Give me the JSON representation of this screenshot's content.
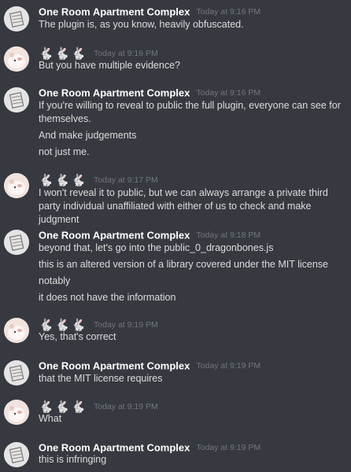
{
  "messages": [
    {
      "author": "One Room Apartment Complex",
      "timestamp": "Today at 9:16 PM",
      "lines": [
        "The plugin is, as you know, heavily obfuscated."
      ]
    },
    {
      "author": "🐇🐇🐇",
      "timestamp": "Today at 9:16 PM",
      "lines": [
        "But you have multiple evidence?"
      ]
    },
    {
      "author": "One Room Apartment Complex",
      "timestamp": "Today at 9:16 PM",
      "lines": [
        "If you're willing to reveal to public the full plugin, everyone can see for themselves.",
        "And make judgements",
        "not just me."
      ]
    },
    {
      "author": "🐇🐇🐇",
      "timestamp": "Today at 9:17 PM",
      "lines": [
        "I won't reveal it to public, but we can always arrange a private third party individual unaffiliated with either of us to check and make judgment"
      ]
    },
    {
      "author": "One Room Apartment Complex",
      "timestamp": "Today at 9:18 PM",
      "lines": [
        "beyond that, let's go into the public_0_dragonbones.js",
        "this is an altered version of a library covered under the MIT license",
        "notably",
        "it does not have the information"
      ]
    },
    {
      "author": "🐇🐇🐇",
      "timestamp": "Today at 9:19 PM",
      "lines": [
        "Yes, that's correct"
      ]
    },
    {
      "author": "One Room Apartment Complex",
      "timestamp": "Today at 9:19 PM",
      "lines": [
        "that the MIT license requires"
      ]
    },
    {
      "author": "🐇🐇🐇",
      "timestamp": "Today at 9:19 PM",
      "lines": [
        "What"
      ]
    },
    {
      "author": "One Room Apartment Complex",
      "timestamp": "Today at 9:19 PM",
      "lines": [
        "this is infringing"
      ]
    }
  ],
  "colors": {
    "background": "#36393f",
    "username": "#ffffff",
    "timestamp": "#72767d",
    "text": "#dcddde"
  }
}
